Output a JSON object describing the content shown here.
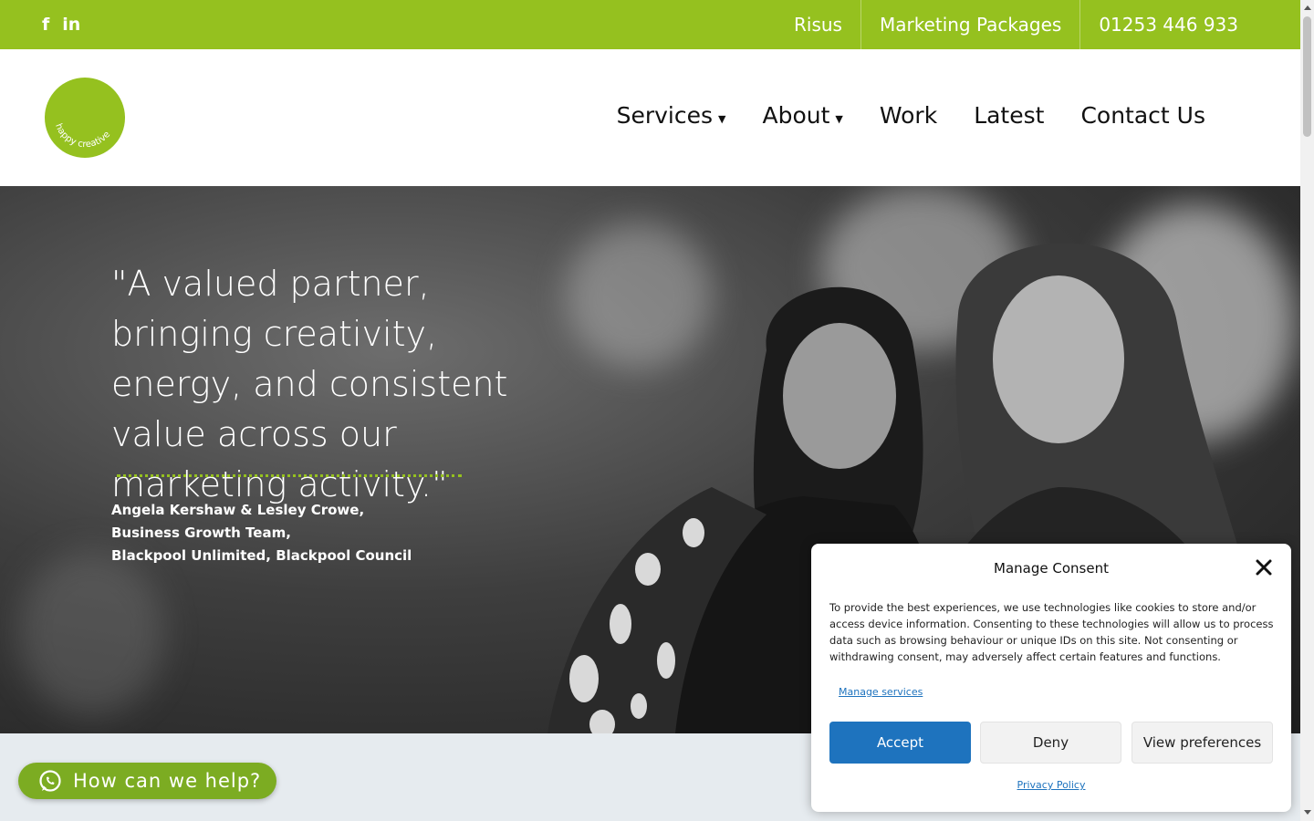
{
  "topbar": {
    "social": [
      {
        "icon": "facebook-icon",
        "glyph": "f"
      },
      {
        "icon": "linkedin-icon",
        "glyph": "in"
      }
    ],
    "links": [
      "Risus",
      "Marketing Packages",
      "01253 446 933"
    ],
    "color": "#95c11f"
  },
  "header": {
    "logo_text": "happy creative",
    "nav": [
      {
        "label": "Services",
        "caret": "▼"
      },
      {
        "label": "About",
        "caret": "▼"
      },
      {
        "label": "Work"
      },
      {
        "label": "Latest"
      },
      {
        "label": "Contact Us"
      }
    ]
  },
  "hero": {
    "quote": "\"A valued partner, bringing creativity, energy, and consistent value across our marketing activity.\"",
    "attribution": [
      "Angela Kershaw & Lesley Crowe,",
      "Business Growth Team,",
      "Blackpool Unlimited, Blackpool Council"
    ]
  },
  "help_button": {
    "label": "How can we help?",
    "icon": "whatsapp-icon"
  },
  "consent": {
    "title": "Manage Consent",
    "body": "To provide the best experiences, we use technologies like cookies to store and/or access device information. Consenting to these technologies will allow us to process data such as browsing behaviour or unique IDs on this site. Not consenting or withdrawing consent, may adversely affect certain features and functions.",
    "manage_services": "Manage services",
    "accept": "Accept",
    "deny": "Deny",
    "view_preferences": "View preferences",
    "privacy_policy": "Privacy Policy",
    "accent": "#1e73be"
  }
}
